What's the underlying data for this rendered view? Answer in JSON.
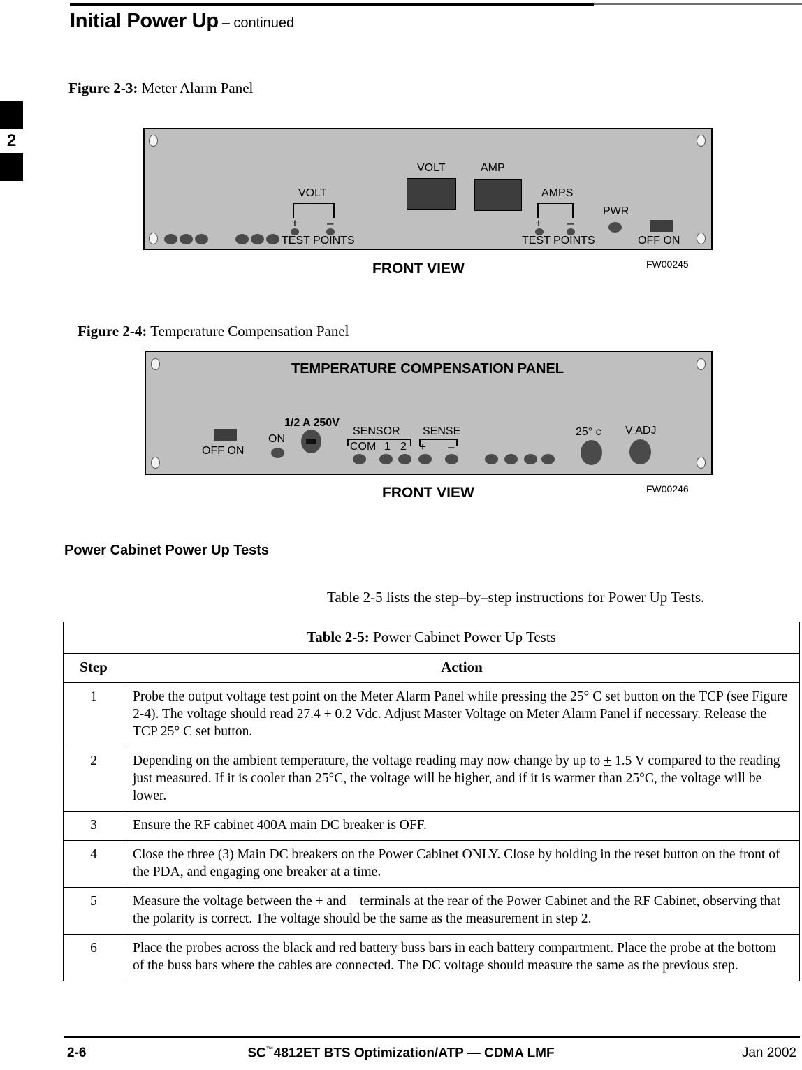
{
  "header": {
    "title": "Initial Power Up",
    "continued": "– continued"
  },
  "chapter_tab": {
    "number": "2"
  },
  "figures": [
    {
      "caption_label": "Figure 2-3:",
      "caption_text": "Meter Alarm Panel",
      "front_view": "FRONT VIEW",
      "drawing_number": "FW00245",
      "labels": {
        "volt_meter": "VOLT",
        "amp_meter": "AMP",
        "volt_bracket": "VOLT",
        "amps_bracket": "AMPS",
        "test_points_left": "TEST POINTS",
        "test_points_right": "TEST POINTS",
        "pwr": "PWR",
        "off_on": "OFF  ON",
        "plus": "+",
        "minus": "–"
      }
    },
    {
      "caption_label": "Figure 2-4:",
      "caption_text": "Temperature Compensation Panel",
      "front_view": "FRONT VIEW",
      "drawing_number": "FW00246",
      "labels": {
        "panel_title": "TEMPERATURE COMPENSATION PANEL",
        "off_on": "OFF  ON",
        "on": "ON",
        "fuse": "1/2 A 250V",
        "sensor": "SENSOR",
        "sense": "SENSE",
        "com": "COM",
        "sensor_1": "1",
        "sensor_2": "2",
        "plus": "+",
        "minus": "–",
        "set_25c": "25° c",
        "v_adj": "V ADJ"
      }
    }
  ],
  "section": {
    "heading": "Power Cabinet Power Up Tests",
    "intro": "Table 2-5 lists the step–by–step instructions for Power Up Tests."
  },
  "table": {
    "title_label": "Table 2-5:",
    "title_text": "Power Cabinet Power Up Tests",
    "columns": [
      "Step",
      "Action"
    ],
    "rows": [
      {
        "step": "1",
        "action_pre": "Probe the output voltage test point on the Meter Alarm Panel while pressing the 25° C set button on the TCP (see Figure 2-4). The voltage should read 27.4 ",
        "action_pm": "+",
        "action_post": " 0.2 Vdc. Adjust Master Voltage on Meter Alarm Panel if necessary. Release the TCP 25° C set button."
      },
      {
        "step": "2",
        "action_pre": "Depending on the ambient temperature, the voltage reading may now change by up to ",
        "action_pm": "+",
        "action_post": " 1.5 V compared to the reading just measured. If it is cooler than 25°C, the voltage will be higher, and if it is warmer than 25°C, the voltage will be lower."
      },
      {
        "step": "3",
        "action_pre": "Ensure the RF cabinet 400A main DC breaker is OFF.",
        "action_pm": "",
        "action_post": ""
      },
      {
        "step": "4",
        "action_pre": "Close the three (3) Main DC breakers on the Power Cabinet ONLY. Close by holding in the reset button on the front of the PDA, and engaging one breaker at a time.",
        "action_pm": "",
        "action_post": ""
      },
      {
        "step": "5",
        "action_pre": "Measure the voltage between the + and – terminals at the rear of the Power Cabinet and the RF Cabinet, observing that the polarity is correct. The voltage should be the same as the measurement in step 2.",
        "action_pm": "",
        "action_post": ""
      },
      {
        "step": "6",
        "action_pre": "Place the probes across the black and red battery buss bars in each battery compartment. Place the probe at the bottom of the buss bars where the cables are connected. The DC voltage should measure the same as the previous step.",
        "action_pm": "",
        "action_post": ""
      }
    ]
  },
  "footer": {
    "page_number": "2-6",
    "document_pre": "SC",
    "document_tm": "™",
    "document_post": "4812ET BTS Optimization/ATP — CDMA LMF",
    "date": "Jan 2002"
  }
}
